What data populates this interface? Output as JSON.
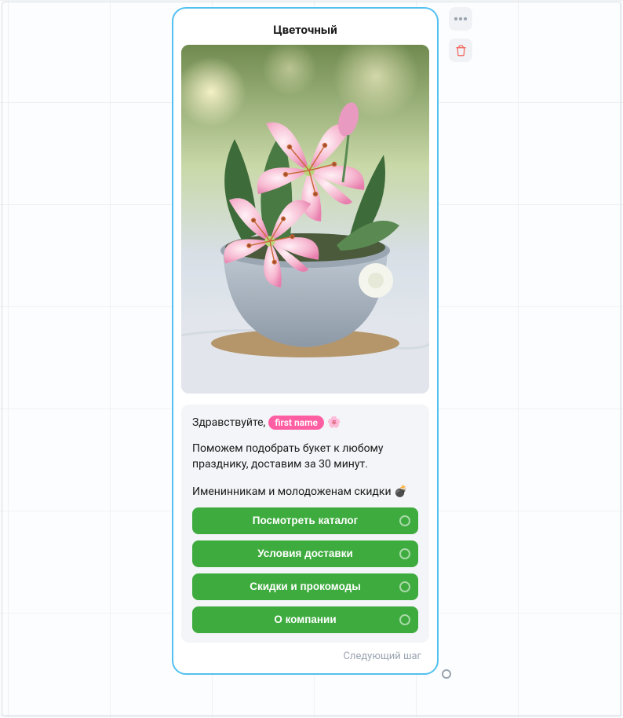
{
  "card": {
    "title": "Цветочный",
    "next_step_label": "Следующий шаг"
  },
  "message": {
    "greeting_prefix": "Здравствуйте,",
    "variable_pill": "first name",
    "flower_emoji": "🌸",
    "paragraph1": "Поможем подобрать букет к любому празднику, доставим за 30 минут.",
    "paragraph2_text": "Именинникам и молодоженам скидки",
    "paragraph2_emoji": "💣"
  },
  "buttons": [
    {
      "label": "Посмотреть каталог"
    },
    {
      "label": "Условия доставки"
    },
    {
      "label": "Скидки и прокомоды"
    },
    {
      "label": "О компании"
    }
  ],
  "side_actions": {
    "more": "more",
    "delete": "delete"
  },
  "colors": {
    "accent_border": "#52c0f0",
    "button_green": "#3eab3e",
    "pill_pink": "#ff5fa2",
    "delete_red": "#f1655b"
  }
}
